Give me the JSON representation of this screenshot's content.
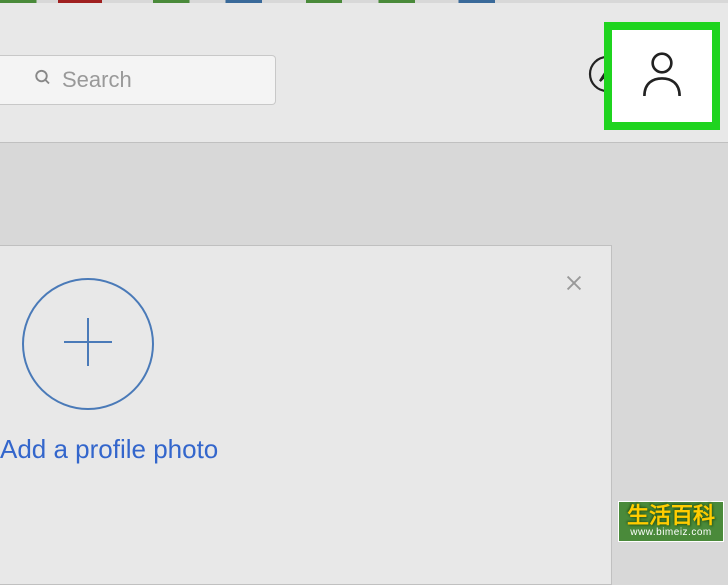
{
  "search": {
    "placeholder": "Search"
  },
  "card": {
    "add_photo_label": "Add a profile photo"
  },
  "watermark": {
    "title": "生活百科",
    "url": "www.bimeiz.com"
  }
}
